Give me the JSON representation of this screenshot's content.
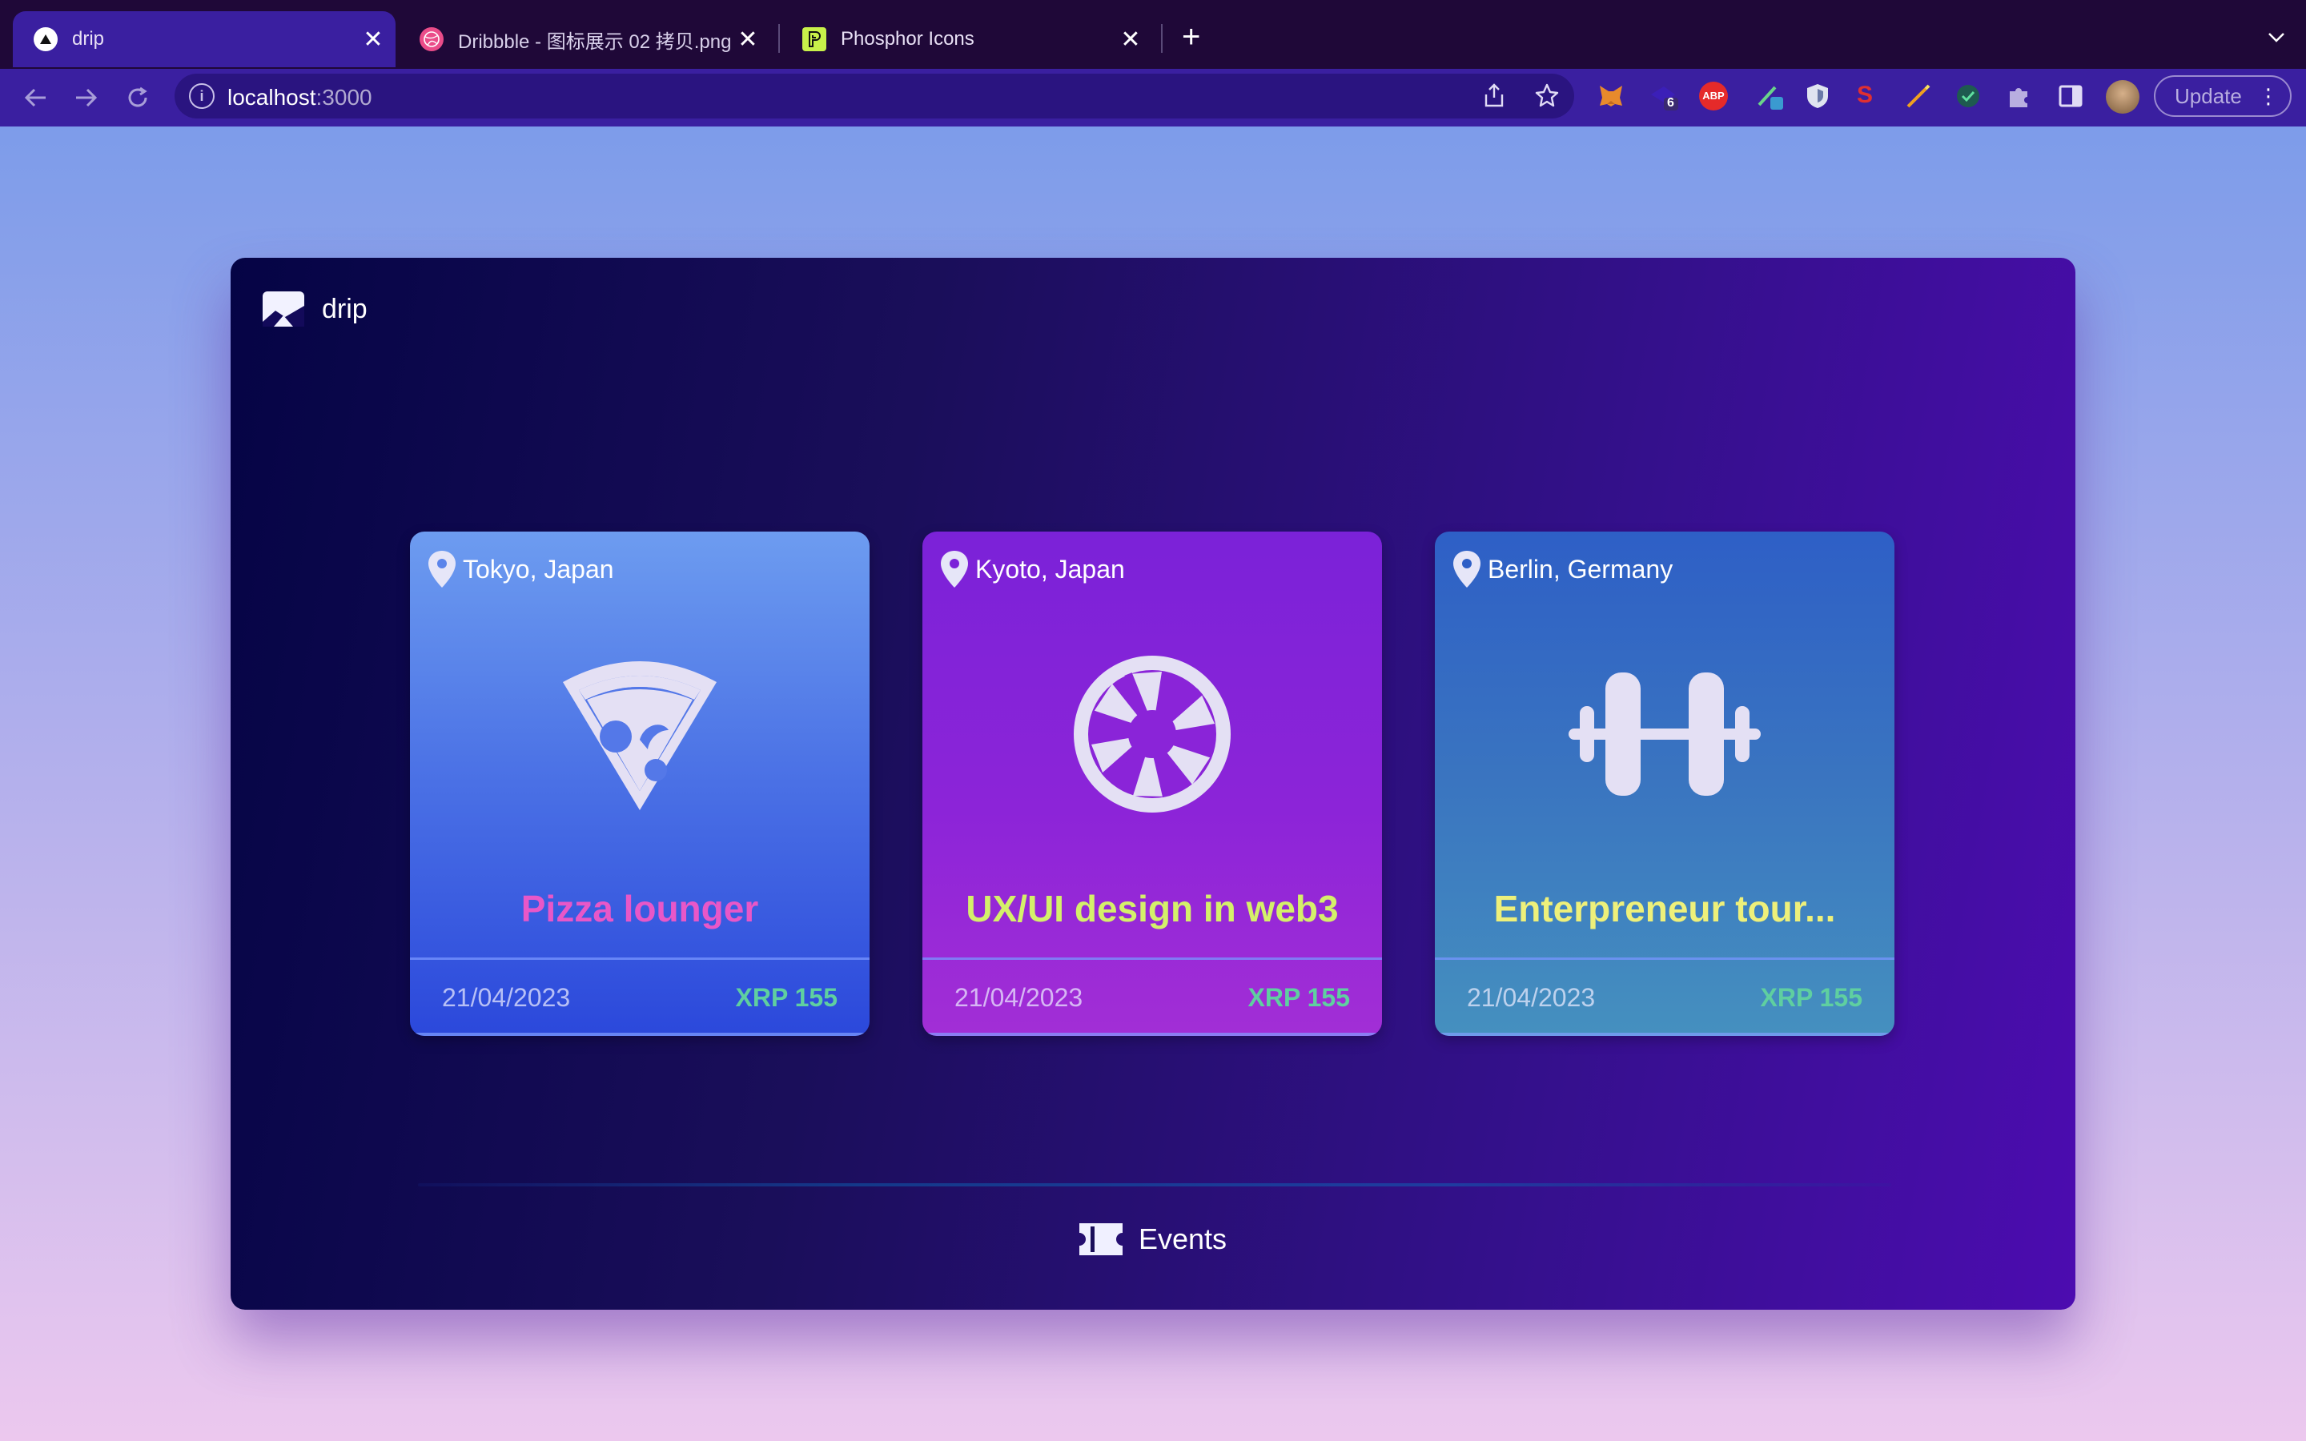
{
  "browser": {
    "tabs": [
      {
        "title": "drip",
        "active": true
      },
      {
        "title": "Dribbble - 图标展示 02 拷贝.png",
        "active": false
      },
      {
        "title": "Phosphor Icons",
        "active": false
      }
    ],
    "new_tab": "+",
    "close_glyph": "✕",
    "url_host": "localhost",
    "url_port": ":3000",
    "extension_badge": "6",
    "abp_label": "ABP",
    "update_label": "Update"
  },
  "app": {
    "brand": "drip",
    "nav_label": "Events",
    "cards": [
      {
        "location": "Tokyo, Japan",
        "name": "Pizza lounger",
        "date": "21/04/2023",
        "price": "XRP 155",
        "icon": "pizza-icon",
        "name_color": "#e857c8"
      },
      {
        "location": "Kyoto, Japan",
        "name": "UX/UI design in web3",
        "date": "21/04/2023",
        "price": "XRP 155",
        "icon": "aperture-icon",
        "name_color": "#d4f06a"
      },
      {
        "location": "Berlin, Germany",
        "name": "Enterpreneur tour...",
        "date": "21/04/2023",
        "price": "XRP 155",
        "icon": "barbell-icon",
        "name_color": "#eef07a"
      }
    ]
  },
  "colors": {
    "accent_price": "#5fcfa0",
    "icon_fill": "#e4e0f4"
  }
}
